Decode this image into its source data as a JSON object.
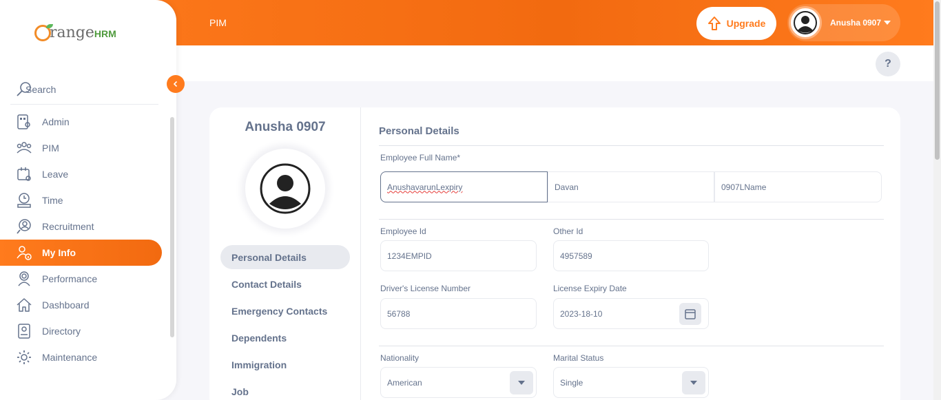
{
  "header": {
    "module": "PIM",
    "upgrade_label": "Upgrade",
    "user_name": "Anusha 0907",
    "help_label": "?"
  },
  "sidebar": {
    "logo_text": "range",
    "logo_suffix": "HRM",
    "search_label": "Search",
    "items": [
      {
        "label": "Admin",
        "icon": "admin-icon"
      },
      {
        "label": "PIM",
        "icon": "pim-icon"
      },
      {
        "label": "Leave",
        "icon": "leave-icon"
      },
      {
        "label": "Time",
        "icon": "time-icon"
      },
      {
        "label": "Recruitment",
        "icon": "recruitment-icon"
      },
      {
        "label": "My Info",
        "icon": "my-info-icon",
        "active": true
      },
      {
        "label": "Performance",
        "icon": "performance-icon"
      },
      {
        "label": "Dashboard",
        "icon": "dashboard-icon"
      },
      {
        "label": "Directory",
        "icon": "directory-icon"
      },
      {
        "label": "Maintenance",
        "icon": "maintenance-icon"
      }
    ]
  },
  "profile": {
    "name": "Anusha 0907",
    "tabs": [
      "Personal Details",
      "Contact Details",
      "Emergency Contacts",
      "Dependents",
      "Immigration",
      "Job"
    ],
    "active_tab": "Personal Details"
  },
  "form": {
    "title": "Personal Details",
    "full_name_label": "Employee Full Name*",
    "first_name": "AnushavarunLexpiry",
    "middle_name": "Davan",
    "last_name": "0907LName",
    "employee_id_label": "Employee Id",
    "employee_id": "1234EMPID",
    "other_id_label": "Other Id",
    "other_id": "4957589",
    "license_label": "Driver's License Number",
    "license": "56788",
    "expiry_label": "License Expiry Date",
    "expiry": "2023-18-10",
    "nationality_label": "Nationality",
    "nationality": "American",
    "marital_label": "Marital Status",
    "marital": "Single"
  },
  "colors": {
    "accent": "#ff7b1d",
    "text": "#64728c"
  }
}
